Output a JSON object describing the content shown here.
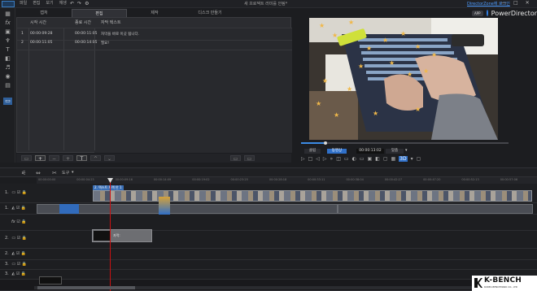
{
  "menu": [
    "파일",
    "편집",
    "보기",
    "재생"
  ],
  "project_title": "새 프로젝트 러미를 안됨*",
  "promo_link": "DirectorZone에 로그인",
  "window_controls": [
    "—",
    "□",
    "✕"
  ],
  "app_badge": "APP",
  "app_name": "PowerDirector",
  "tabs": [
    "캡처",
    "편집",
    "제작",
    "디스크 만들기"
  ],
  "active_tab": "편집",
  "subtitle_table": {
    "columns": [
      "시작 시간",
      "종료 시간",
      "자막 텍스트"
    ],
    "rows": [
      {
        "num": "1",
        "start": "00:00:09:28",
        "end": "00:00:11:05",
        "text": "자막을 바로 이곳 됩니다."
      },
      {
        "num": "2",
        "start": "00:00:11:05",
        "end": "00:00:14:05",
        "text": "필요!"
      }
    ]
  },
  "preview": {
    "mode_clip": "클립",
    "mode_movie": "동영상",
    "timecode": "00:00:13:02",
    "fit": "맞춤",
    "viewer_icon": "3D"
  },
  "timeline": {
    "tool_label": "도구",
    "ruler_ticks": [
      "00:00:00:00",
      "00:00:04:23",
      "00:00:09:16",
      "00:00:14:09",
      "00:00:19:02",
      "00:00:23:25",
      "00:00:28:18",
      "00:00:33:11",
      "00:00:38:04",
      "00:00:42:27",
      "00:00:47:20",
      "00:00:52:13",
      "00:00:57:06"
    ],
    "clip_tooltip": "2. 텍스트 트랙 안 1",
    "title_clip_label": "자막:",
    "track_labels": [
      "1.",
      "1.",
      "fx",
      "2.",
      "2.",
      "3.",
      "3."
    ]
  },
  "watermark": {
    "brand": "K-BENCH",
    "sub": "KOREA BENCHMARK CO., LTD"
  }
}
